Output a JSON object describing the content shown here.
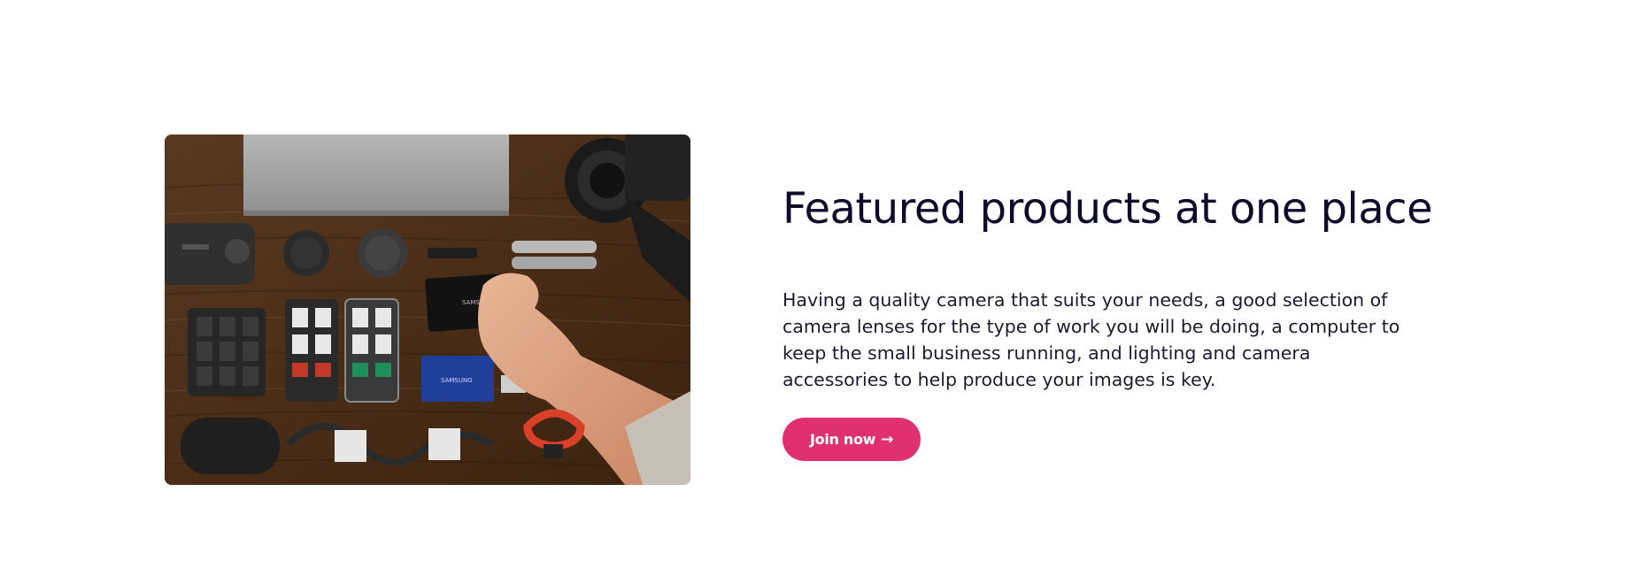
{
  "feature": {
    "image_alt": "Flat lay of camera gear on a wooden desk",
    "image_text": {
      "ssd_brand_black": "SAMSUNG",
      "ssd_brand_blue": "SAMSUNG"
    },
    "title": "Featured products at one place",
    "description": "Having a quality camera that suits your needs, a good selection of camera lenses for the type of work you will be doing, a computer to keep the small business running, and lighting and camera accessories to help produce your images is key.",
    "cta": {
      "label": "Join now",
      "icon": "arrow-right-icon",
      "arrow_glyph": "→"
    }
  },
  "colors": {
    "title": "#0e0b2b",
    "body_text": "#1b1b2b",
    "button_bg": "#e0306f",
    "button_text": "#ffffff",
    "background": "#ffffff"
  }
}
